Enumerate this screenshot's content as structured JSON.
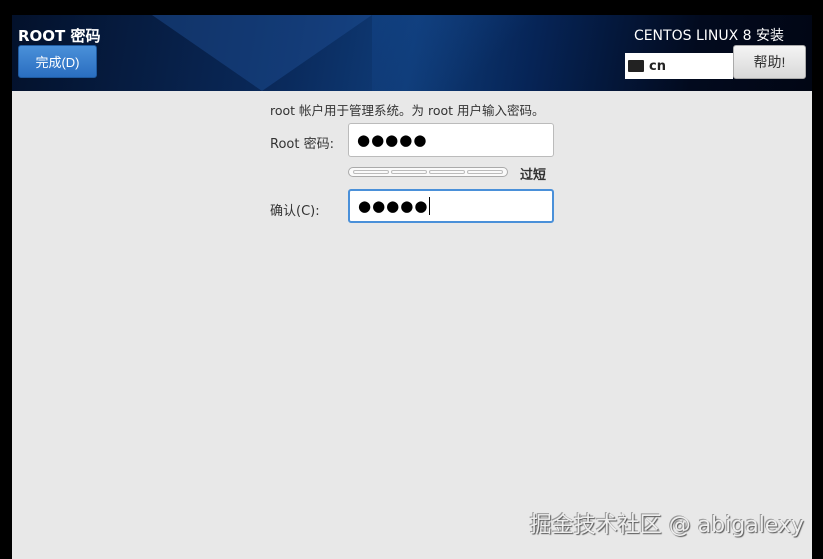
{
  "header": {
    "title": "ROOT 密码",
    "done_label": "完成(D)",
    "product": "CENTOS LINUX 8 安装",
    "keyboard_layout": "cn",
    "help_label": "帮助!"
  },
  "form": {
    "description": "root 帐户用于管理系统。为 root 用户输入密码。",
    "root_password_label": "Root 密码:",
    "root_password_value": "●●●●●",
    "strength_label": "过短",
    "strength_level": 0,
    "confirm_label": "确认(C):",
    "confirm_value": "●●●●●"
  },
  "watermark": "掘金技术社区 @ abigalexy"
}
